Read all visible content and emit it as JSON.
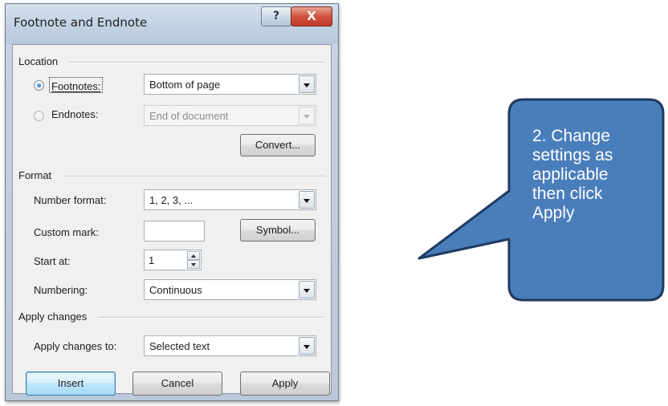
{
  "dialog": {
    "title": "Footnote and Endnote",
    "help_glyph": "?",
    "close_glyph": "X",
    "location": {
      "section_label": "Location",
      "footnotes": {
        "label": "Footnotes:",
        "value": "Bottom of page",
        "selected": true
      },
      "endnotes": {
        "label": "Endnotes:",
        "value": "End of document",
        "selected": false
      },
      "convert_label": "Convert..."
    },
    "format": {
      "section_label": "Format",
      "number_format": {
        "label": "Number format:",
        "value": "1, 2, 3, ..."
      },
      "custom_mark": {
        "label": "Custom mark:",
        "value": ""
      },
      "symbol_label": "Symbol...",
      "start_at": {
        "label": "Start at:",
        "value": "1"
      },
      "numbering": {
        "label": "Numbering:",
        "value": "Continuous"
      }
    },
    "apply_changes": {
      "section_label": "Apply changes",
      "apply_to": {
        "label": "Apply changes to:",
        "value": "Selected text"
      }
    },
    "buttons": {
      "insert": "Insert",
      "cancel": "Cancel",
      "apply": "Apply"
    }
  },
  "callout": {
    "lines": [
      "2. Change",
      "settings as",
      "applicable",
      "then click",
      "Apply"
    ],
    "fill_color": "#4a7ebb",
    "border_color": "#1f3b5f"
  },
  "colors": {
    "titlebar": "#c2d2e3",
    "client_bg": "#f0f0f0",
    "close_button": "#c0392b",
    "default_button": "#bee6fd"
  }
}
